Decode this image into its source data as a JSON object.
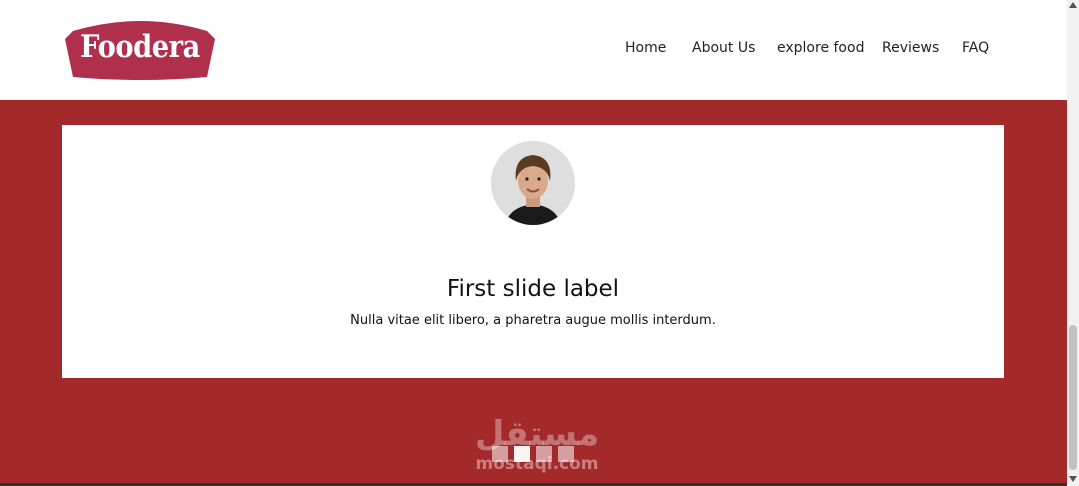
{
  "brand": {
    "name": "Foodera",
    "color": "#b02f4c"
  },
  "nav": {
    "items": [
      {
        "label": "Home"
      },
      {
        "label": "About Us"
      },
      {
        "label": "explore food"
      },
      {
        "label": "Reviews"
      },
      {
        "label": "FAQ"
      }
    ]
  },
  "carousel": {
    "slide": {
      "title": "First slide label",
      "caption": "Nulla vitae elit libero, a pharetra augue mollis interdum."
    },
    "indicators": {
      "count": 4,
      "active_index": 1
    }
  },
  "watermark": {
    "arabic": "مستقل",
    "domain": "mostaqi.com"
  },
  "colors": {
    "background": "#a3292a",
    "card": "#ffffff",
    "text": "#111111"
  }
}
